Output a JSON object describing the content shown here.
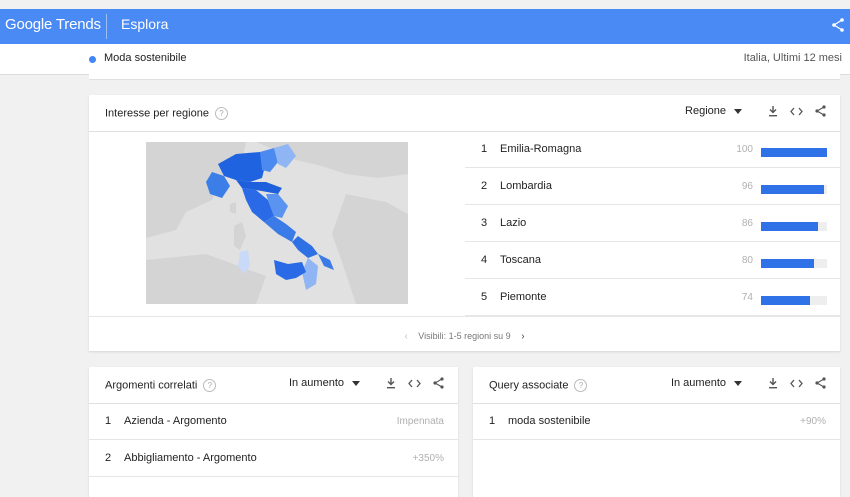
{
  "header": {
    "brand": "Google Trends",
    "nav_title": "Esplora"
  },
  "subheader": {
    "search_term": "Moda sostenibile",
    "scope": "Italia, Ultimi 12 mesi",
    "term_color": "#4285f4"
  },
  "region_card": {
    "title": "Interesse per regione",
    "resolution": "Regione",
    "rows": [
      {
        "rank": "1",
        "name": "Emilia-Romagna",
        "value": "100",
        "level": 100
      },
      {
        "rank": "2",
        "name": "Lombardia",
        "value": "96",
        "level": 96
      },
      {
        "rank": "3",
        "name": "Lazio",
        "value": "86",
        "level": 86
      },
      {
        "rank": "4",
        "name": "Toscana",
        "value": "80",
        "level": 80
      },
      {
        "rank": "5",
        "name": "Piemonte",
        "value": "74",
        "level": 74
      }
    ],
    "pagination": "Visibili: 1-5 regioni su 9"
  },
  "topics_card": {
    "title": "Argomenti correlati",
    "filter": "In aumento",
    "rows": [
      {
        "rank": "1",
        "name": "Azienda - Argomento",
        "value": "Impennata"
      },
      {
        "rank": "2",
        "name": "Abbigliamento - Argomento",
        "value": "+350%"
      }
    ]
  },
  "queries_card": {
    "title": "Query associate",
    "filter": "In aumento",
    "rows": [
      {
        "rank": "1",
        "name": "moda sostenibile",
        "value": "+90%"
      }
    ]
  },
  "colors": {
    "accent": "#4a8af4",
    "bar": "#2f72e8"
  }
}
